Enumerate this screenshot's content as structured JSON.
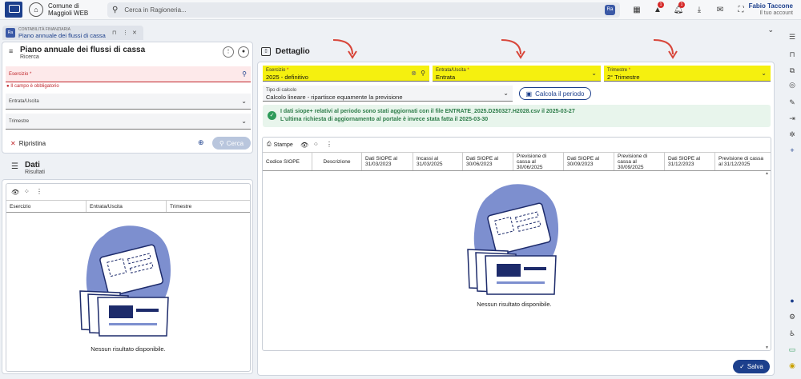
{
  "header": {
    "org_line1": "Comune di",
    "org_line2": "Maggioli WEB",
    "search_placeholder": "Cerca in Ragioneria...",
    "search_badge": "Ra",
    "notif_badge_1": "1",
    "notif_badge_2": "1",
    "user_name": "Fabio Taccone",
    "user_link": "Il tuo account"
  },
  "tab": {
    "module": "CONTABILITÀ FINANZIARIA",
    "title": "Piano annuale dei flussi di cassa",
    "badge": "Ra"
  },
  "search_panel": {
    "title": "Piano annuale dei flussi di cassa",
    "subtitle": "Ricerca",
    "esercizio_label": "Esercizio",
    "required_mark": "*",
    "error_text": "Il campo è obbligatorio",
    "entrata_label": "Entrata/Uscita",
    "trimestre_label": "Trimestre",
    "reset_label": "Ripristina",
    "search_label": "Cerca"
  },
  "results_panel": {
    "title": "Dati",
    "subtitle": "Risultati",
    "columns": [
      "Esercizio",
      "Entrata/Uscita",
      "Trimestre"
    ],
    "empty_text": "Nessun risultato disponibile."
  },
  "detail_panel": {
    "title": "Dettaglio",
    "esercizio_label": "Esercizio",
    "esercizio_value": "2025 - definitivo",
    "entrata_label": "Entrata/Uscita",
    "entrata_value": "Entrata",
    "trimestre_label": "Trimestre",
    "trimestre_value": "2° Trimestre",
    "tipo_label": "Tipo di calcolo",
    "tipo_value": "Calcolo lineare - ripartisce equamente la previsione",
    "calcola_label": "Calcola il periodo",
    "info_line1": "I dati siope+ relativi al periodo sono stati aggiornati con il file ENTRATE_2025.D250327.H2028.csv il 2025-03-27",
    "info_line2": "L'ultima richiesta di aggiornamento al portale è invece stata fatta il 2025-03-30",
    "stampe_label": "Stampe",
    "columns": [
      "Codice SIOPE",
      "Descrizione",
      "Dati SIOPE al 31/03/2023",
      "Incassi al 31/03/2025",
      "Dati SIOPE al 30/06/2023",
      "Previsione di cassa al 30/06/2025",
      "Dati SIOPE al 30/09/2023",
      "Previsione di cassa al 30/09/2025",
      "Dati SIOPE al 31/12/2023",
      "Previsione di cassa al 31/12/2025"
    ],
    "empty_text": "Nessun risultato disponibile.",
    "save_label": "Salva"
  },
  "colors": {
    "accent": "#1c3f8c",
    "highlight": "#f5f00f",
    "error": "#c0262b",
    "success": "#2e9b5a",
    "annotation_arrow": "#d8463a"
  }
}
